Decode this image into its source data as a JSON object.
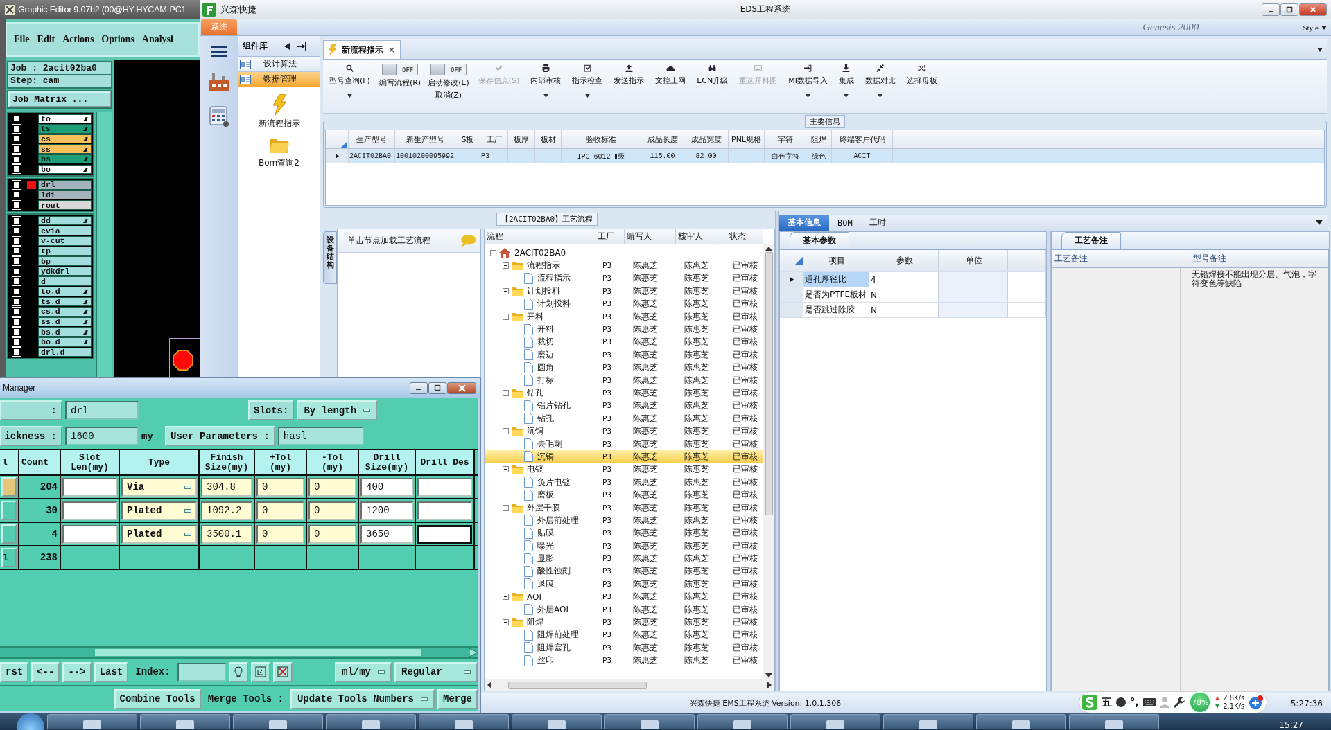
{
  "graphic_editor": {
    "title": "Graphic Editor 9.07b2 (00@HY-HYCAM-PC1",
    "menu": [
      "File",
      "Edit",
      "Actions",
      "Options",
      "Analysi"
    ],
    "job": "Job : 2acit02ba0",
    "step": "Step: cam",
    "job_matrix": "Job Matrix ...",
    "layer_groups": [
      {
        "layers": [
          {
            "name": "to",
            "color": "#ffffff",
            "arrow": true,
            "active": false,
            "checked": false
          },
          {
            "name": "ts",
            "color": "#1e9e78",
            "arrow": true,
            "active": false,
            "checked": false
          },
          {
            "name": "cs",
            "color": "#f7c25c",
            "arrow": true,
            "active": false,
            "checked": false
          },
          {
            "name": "ss",
            "color": "#f7c25c",
            "arrow": true,
            "active": false,
            "checked": false
          },
          {
            "name": "bs",
            "color": "#1e9e78",
            "arrow": true,
            "active": false,
            "checked": false
          },
          {
            "name": "bo",
            "color": "#ffffff",
            "arrow": true,
            "active": false,
            "checked": false
          }
        ]
      },
      {
        "layers": [
          {
            "name": "drl",
            "color": "#a3b4bc",
            "arrow": false,
            "active": true,
            "checked": false
          },
          {
            "name": "ldi",
            "color": "#a3b4bc",
            "arrow": false,
            "active": false,
            "checked": false
          },
          {
            "name": "rout",
            "color": "#d9d9d9",
            "arrow": false,
            "active": false,
            "checked": false
          }
        ]
      },
      {
        "layers": [
          {
            "name": "dd",
            "color": "#a2dede",
            "arrow": true,
            "active": false,
            "checked": false
          },
          {
            "name": "cvia",
            "color": "#a2dede",
            "arrow": false,
            "active": false,
            "checked": false
          },
          {
            "name": "v-cut",
            "color": "#a2dede",
            "arrow": false,
            "active": false,
            "checked": false
          },
          {
            "name": "tp",
            "color": "#a2dede",
            "arrow": false,
            "active": false,
            "checked": false
          },
          {
            "name": "bp",
            "color": "#a2dede",
            "arrow": false,
            "active": false,
            "checked": false
          },
          {
            "name": "ydkdrl",
            "color": "#a2dede",
            "arrow": false,
            "active": false,
            "checked": false
          },
          {
            "name": "d",
            "color": "#a2dede",
            "arrow": false,
            "active": false,
            "checked": false
          },
          {
            "name": "to.d",
            "color": "#a2dede",
            "arrow": true,
            "active": false,
            "checked": false
          },
          {
            "name": "ts.d",
            "color": "#a2dede",
            "arrow": true,
            "active": false,
            "checked": false
          },
          {
            "name": "cs.d",
            "color": "#a2dede",
            "arrow": true,
            "active": false,
            "checked": false
          },
          {
            "name": "ss.d",
            "color": "#a2dede",
            "arrow": true,
            "active": false,
            "checked": false
          },
          {
            "name": "bs.d",
            "color": "#a2dede",
            "arrow": true,
            "active": false,
            "checked": false
          },
          {
            "name": "bo.d",
            "color": "#a2dede",
            "arrow": true,
            "active": false,
            "checked": false
          },
          {
            "name": "drl.d",
            "color": "#a2dede",
            "arrow": false,
            "active": false,
            "checked": false
          }
        ]
      }
    ]
  },
  "eds": {
    "app_name": "兴森快捷",
    "title": "EDS工程系统",
    "system_tab": "系统",
    "background_text": [
      "Genesis 2000",
      "Style"
    ],
    "component_panel": {
      "title": "组件库",
      "categories": [
        {
          "label": "设计算法",
          "selected": false
        },
        {
          "label": "数据管理",
          "selected": true
        }
      ],
      "items": [
        {
          "label": "新流程指示",
          "kind": "lightning"
        },
        {
          "label": "Bom查询2",
          "kind": "folder"
        }
      ]
    },
    "doc_tabs": [
      {
        "label": "新流程指示",
        "selected": true
      }
    ],
    "toolbar": [
      {
        "kind": "button",
        "label": "型号查询(F)",
        "disabled": false,
        "dropdown": true
      },
      {
        "kind": "toggle",
        "toggle": "OFF",
        "on": false,
        "label": "编写流程(R)"
      },
      {
        "kind": "toggle",
        "toggle": "OFF",
        "on": false,
        "label": "启动修改(E)",
        "label2": "取消(Z)"
      },
      {
        "kind": "button",
        "label": "保存信息(S)",
        "disabled": true,
        "dropdown": false
      },
      {
        "kind": "button",
        "label": "内部审核",
        "disabled": false,
        "dropdown": true
      },
      {
        "kind": "button",
        "label": "指示检查",
        "disabled": false,
        "dropdown": true
      },
      {
        "kind": "button",
        "label": "发送指示",
        "disabled": false,
        "dropdown": false
      },
      {
        "kind": "button",
        "label": "文控上网",
        "disabled": false,
        "dropdown": false
      },
      {
        "kind": "button",
        "label": "ECN升级",
        "disabled": false,
        "dropdown": false
      },
      {
        "kind": "button",
        "label": "重选开料图",
        "disabled": true,
        "dropdown": false
      },
      {
        "kind": "button",
        "label": "MI数据导入",
        "disabled": false,
        "dropdown": true
      },
      {
        "kind": "button",
        "label": "集成",
        "disabled": false,
        "dropdown": true
      },
      {
        "kind": "button",
        "label": "数据对比",
        "disabled": false,
        "dropdown": true
      },
      {
        "kind": "button",
        "label": "选择母板",
        "disabled": false,
        "dropdown": false
      }
    ],
    "main_info": {
      "title": "主要信息",
      "columns": [
        "生产型号",
        "新生产型号",
        "S板",
        "工厂",
        "板厚",
        "板材",
        "验收标准",
        "成品长度",
        "成品宽度",
        "PNL规格",
        "字符",
        "阻焊",
        "终端客户代码"
      ],
      "rows": [
        {
          "selected": true,
          "cells": [
            "2ACIT02BA0",
            "10010200095992",
            null,
            "P3",
            null,
            null,
            "IPC-6012 Ⅱ级",
            "115.00",
            "82.00",
            null,
            "白色字符",
            "绿色",
            "ACIT"
          ]
        }
      ]
    },
    "flow": {
      "title": "【2ACIT02BA0】工艺流程",
      "side_tab": "设备结构",
      "hint": "单击节点加载工艺流程",
      "columns": [
        "流程",
        "工厂",
        "编写人",
        "核审人",
        "状态"
      ],
      "tree": {
        "name": "2ACIT02BA0",
        "expanded": true,
        "selected": false,
        "children": [
          {
            "name": "流程指示",
            "factory": "P3",
            "writer": "陈惠芝",
            "reviewer": "陈惠芝",
            "status": "已审核",
            "expanded": true,
            "selected": false,
            "children": [
              {
                "name": "流程指示",
                "factory": "P3",
                "writer": "陈惠芝",
                "reviewer": "陈惠芝",
                "status": "已审核",
                "selected": false
              }
            ]
          },
          {
            "name": "计划投料",
            "factory": "P3",
            "writer": "陈惠芝",
            "reviewer": "陈惠芝",
            "status": "已审核",
            "expanded": true,
            "selected": false,
            "children": [
              {
                "name": "计划投料",
                "factory": "P3",
                "writer": "陈惠芝",
                "reviewer": "陈惠芝",
                "status": "已审核",
                "selected": false
              }
            ]
          },
          {
            "name": "开料",
            "factory": "P3",
            "writer": "陈惠芝",
            "reviewer": "陈惠芝",
            "status": "已审核",
            "expanded": true,
            "selected": false,
            "children": [
              {
                "name": "开料",
                "factory": "P3",
                "writer": "陈惠芝",
                "reviewer": "陈惠芝",
                "status": "已审核",
                "selected": false
              },
              {
                "name": "裁切",
                "factory": "P3",
                "writer": "陈惠芝",
                "reviewer": "陈惠芝",
                "status": "已审核",
                "selected": false
              },
              {
                "name": "磨边",
                "factory": "P3",
                "writer": "陈惠芝",
                "reviewer": "陈惠芝",
                "status": "已审核",
                "selected": false
              },
              {
                "name": "圆角",
                "factory": "P3",
                "writer": "陈惠芝",
                "reviewer": "陈惠芝",
                "status": "已审核",
                "selected": false
              },
              {
                "name": "打标",
                "factory": "P3",
                "writer": "陈惠芝",
                "reviewer": "陈惠芝",
                "status": "已审核",
                "selected": false
              }
            ]
          },
          {
            "name": "钻孔",
            "factory": "P3",
            "writer": "陈惠芝",
            "reviewer": "陈惠芝",
            "status": "已审核",
            "expanded": true,
            "selected": false,
            "children": [
              {
                "name": "铝片钻孔",
                "factory": "P3",
                "writer": "陈惠芝",
                "reviewer": "陈惠芝",
                "status": "已审核",
                "selected": false
              },
              {
                "name": "钻孔",
                "factory": "P3",
                "writer": "陈惠芝",
                "reviewer": "陈惠芝",
                "status": "已审核",
                "selected": false
              }
            ]
          },
          {
            "name": "沉铜",
            "factory": "P3",
            "writer": "陈惠芝",
            "reviewer": "陈惠芝",
            "status": "已审核",
            "expanded": true,
            "selected": false,
            "children": [
              {
                "name": "去毛刺",
                "factory": "P3",
                "writer": "陈惠芝",
                "reviewer": "陈惠芝",
                "status": "已审核",
                "selected": false
              },
              {
                "name": "沉铜",
                "factory": "P3",
                "writer": "陈惠芝",
                "reviewer": "陈惠芝",
                "status": "已审核",
                "selected": true
              }
            ]
          },
          {
            "name": "电镀",
            "factory": "P3",
            "writer": "陈惠芝",
            "reviewer": "陈惠芝",
            "status": "已审核",
            "expanded": true,
            "selected": false,
            "children": [
              {
                "name": "负片电镀",
                "factory": "P3",
                "writer": "陈惠芝",
                "reviewer": "陈惠芝",
                "status": "已审核",
                "selected": false
              },
              {
                "name": "磨板",
                "factory": "P3",
                "writer": "陈惠芝",
                "reviewer": "陈惠芝",
                "status": "已审核",
                "selected": false
              }
            ]
          },
          {
            "name": "外层干膜",
            "factory": "P3",
            "writer": "陈惠芝",
            "reviewer": "陈惠芝",
            "status": "已审核",
            "expanded": true,
            "selected": false,
            "children": [
              {
                "name": "外层前处理",
                "factory": "P3",
                "writer": "陈惠芝",
                "reviewer": "陈惠芝",
                "status": "已审核",
                "selected": false
              },
              {
                "name": "贴膜",
                "factory": "P3",
                "writer": "陈惠芝",
                "reviewer": "陈惠芝",
                "status": "已审核",
                "selected": false
              },
              {
                "name": "曝光",
                "factory": "P3",
                "writer": "陈惠芝",
                "reviewer": "陈惠芝",
                "status": "已审核",
                "selected": false
              },
              {
                "name": "显影",
                "factory": "P3",
                "writer": "陈惠芝",
                "reviewer": "陈惠芝",
                "status": "已审核",
                "selected": false
              },
              {
                "name": "酸性蚀刻",
                "factory": "P3",
                "writer": "陈惠芝",
                "reviewer": "陈惠芝",
                "status": "已审核",
                "selected": false
              },
              {
                "name": "退膜",
                "factory": "P3",
                "writer": "陈惠芝",
                "reviewer": "陈惠芝",
                "status": "已审核",
                "selected": false
              }
            ]
          },
          {
            "name": "AOI",
            "factory": "P3",
            "writer": "陈惠芝",
            "reviewer": "陈惠芝",
            "status": "已审核",
            "expanded": true,
            "selected": false,
            "children": [
              {
                "name": "外层AOI",
                "factory": "P3",
                "writer": "陈惠芝",
                "reviewer": "陈惠芝",
                "status": "已审核",
                "selected": false
              }
            ]
          },
          {
            "name": "阻焊",
            "factory": "P3",
            "writer": "陈惠芝",
            "reviewer": "陈惠芝",
            "status": "已审核",
            "expanded": true,
            "selected": false,
            "children": [
              {
                "name": "阻焊前处理",
                "factory": "P3",
                "writer": "陈惠芝",
                "reviewer": "陈惠芝",
                "status": "已审核",
                "selected": false
              },
              {
                "name": "阻焊塞孔",
                "factory": "P3",
                "writer": "陈惠芝",
                "reviewer": "陈惠芝",
                "status": "已审核",
                "selected": false
              },
              {
                "name": "丝印",
                "factory": "P3",
                "writer": "陈惠芝",
                "reviewer": "陈惠芝",
                "status": "已审核",
                "selected": false
              }
            ]
          }
        ]
      }
    },
    "detail": {
      "tabs": [
        {
          "label": "基本信息",
          "selected": true
        },
        {
          "label": "BOM",
          "selected": false
        },
        {
          "label": "工时",
          "selected": false
        }
      ],
      "sub_tab": "基本参数",
      "columns": [
        "项目",
        "参数",
        "单位"
      ],
      "rows": [
        {
          "item": "通孔厚径比",
          "value": "4",
          "selected": true
        },
        {
          "item": "是否为PTFE板材",
          "value": "N",
          "selected": false
        },
        {
          "item": "是否跳过除胶",
          "value": "N",
          "selected": false
        }
      ],
      "remarks_tab": "工艺备注",
      "remark_columns": [
        "工艺备注",
        "型号备注"
      ],
      "model_remark": "无铅焊接不能出现分层、气泡，字符变色等缺陷"
    },
    "status_bar": {
      "text": "兴森快捷 EMS工程系统 Version: 1.0.1.306",
      "time": "5:27:36"
    }
  },
  "ime_bar": {
    "mode": "五",
    "punct": "°,",
    "percent": "78%",
    "up": "2.8K/s",
    "down": "2.1K/s"
  },
  "tool_manager": {
    "title": "Manager",
    "layer_label": ":",
    "layer": "drl",
    "slots_label": "Slots:",
    "slots": "By length",
    "thickness_label": "ickness :",
    "thickness": "1600",
    "thickness_unit": "my",
    "user_params": "User Parameters :",
    "user_params_value": "hasl",
    "columns": [
      "l",
      "Count",
      "Slot Len(my)",
      "Type",
      "Finish Size(my)",
      "+Tol (my)",
      "-Tol (my)",
      "Drill Size(my)",
      "Drill Des"
    ],
    "rows": [
      {
        "color": "#e6c77a",
        "count": "204",
        "type": "Via",
        "finish": "304.8",
        "plus_tol": "0",
        "minus_tol": "0",
        "drill": "400",
        "des_focused": false
      },
      {
        "color": "#52cdb0",
        "count": "30",
        "type": "Plated",
        "finish": "1092.2",
        "plus_tol": "0",
        "minus_tol": "0",
        "drill": "1200",
        "des_focused": false
      },
      {
        "color": "#52cdb0",
        "count": "4",
        "type": "Plated",
        "finish": "3500.1",
        "plus_tol": "0",
        "minus_tol": "0",
        "drill": "3650",
        "des_focused": true
      }
    ],
    "total": {
      "label": "l",
      "count": "238"
    },
    "nav": [
      "rst",
      "<--",
      "-->",
      "Last"
    ],
    "index_label": "Index:",
    "units": "ml/my",
    "mode": "Regular",
    "combine": "Combine Tools",
    "merge_label": "Merge Tools :",
    "merge_mode": "Update Tools Numbers",
    "merge": "Merge"
  },
  "taskbar": {
    "clock": "15:27"
  }
}
